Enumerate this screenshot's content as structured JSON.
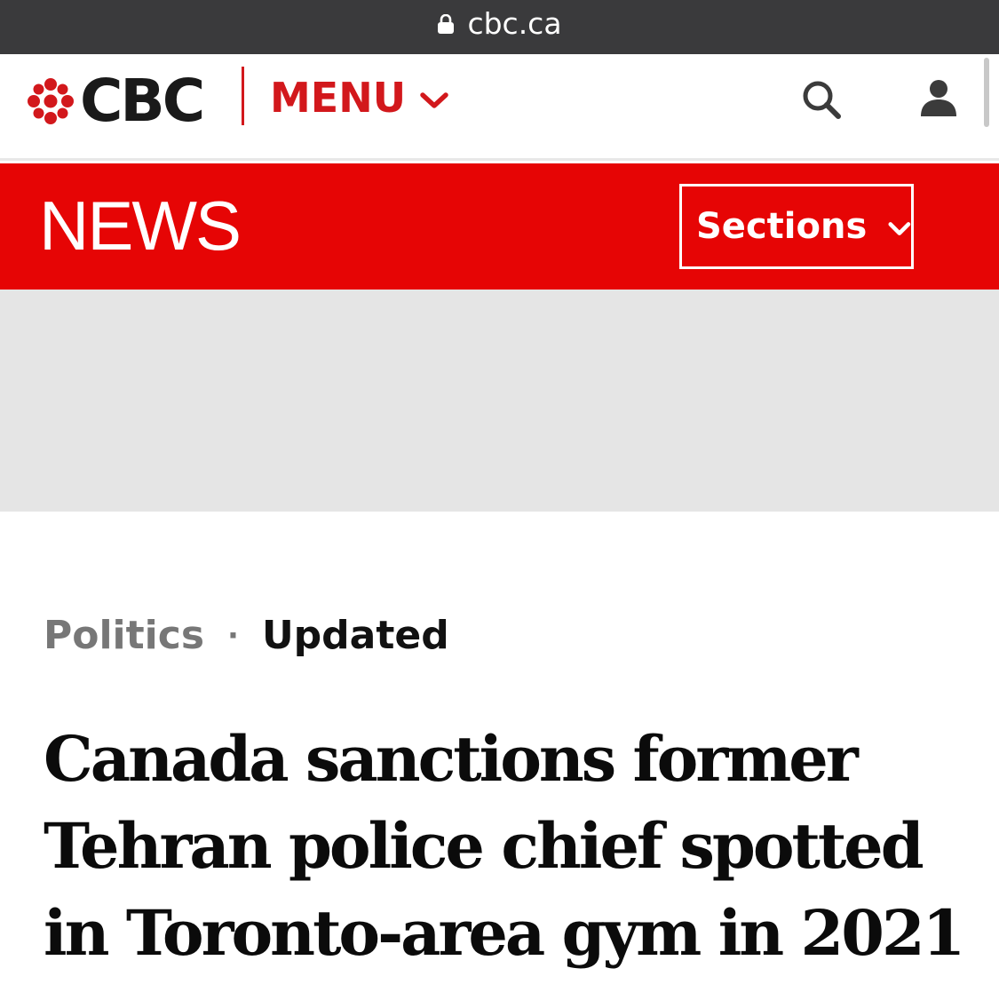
{
  "browser": {
    "url": "cbc.ca",
    "lock_icon": "lock-icon"
  },
  "header": {
    "logo_text": "CBC",
    "menu_label": "MENU",
    "icons": [
      "cbc-gem-icon",
      "chevron-down-icon",
      "search-icon",
      "account-icon"
    ]
  },
  "news_bar": {
    "title": "NEWS",
    "sections_label": "Sections"
  },
  "article": {
    "category": "Politics",
    "separator": "·",
    "status": "Updated",
    "headline": "Canada sanctions former Tehran police chief spotted in Toronto-area gym in 2021"
  },
  "colors": {
    "brand_red": "#e60505",
    "logo_red": "#d2181c",
    "url_bar": "#3a3a3c",
    "ad_gray": "#e5e5e5"
  }
}
